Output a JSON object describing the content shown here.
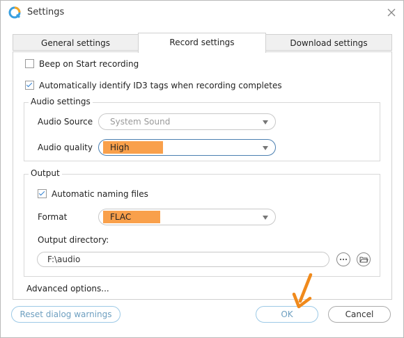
{
  "window": {
    "title": "Settings"
  },
  "tabs": [
    {
      "label": "General settings",
      "active": false
    },
    {
      "label": "Record settings",
      "active": true
    },
    {
      "label": "Download settings",
      "active": false
    }
  ],
  "record": {
    "beep": {
      "label": "Beep on Start recording",
      "checked": false
    },
    "id3": {
      "label": "Automatically identify ID3 tags when recording completes",
      "checked": true
    },
    "audio_settings": {
      "title": "Audio settings",
      "source": {
        "label": "Audio Source",
        "value": "System Sound"
      },
      "quality": {
        "label": "Audio quality",
        "value": "High"
      }
    },
    "output": {
      "title": "Output",
      "auto_naming": {
        "label": "Automatic naming files",
        "checked": true
      },
      "format": {
        "label": "Format",
        "value": "FLAC"
      },
      "directory": {
        "label": "Output directory:",
        "value": "F:\\audio"
      }
    },
    "advanced": "Advanced options..."
  },
  "buttons": {
    "reset": "Reset dialog warnings",
    "ok": "OK",
    "cancel": "Cancel"
  },
  "colors": {
    "accent": "#2f7fd0",
    "highlight": "#f9a04b",
    "annotation_arrow": "#f08a1c"
  }
}
